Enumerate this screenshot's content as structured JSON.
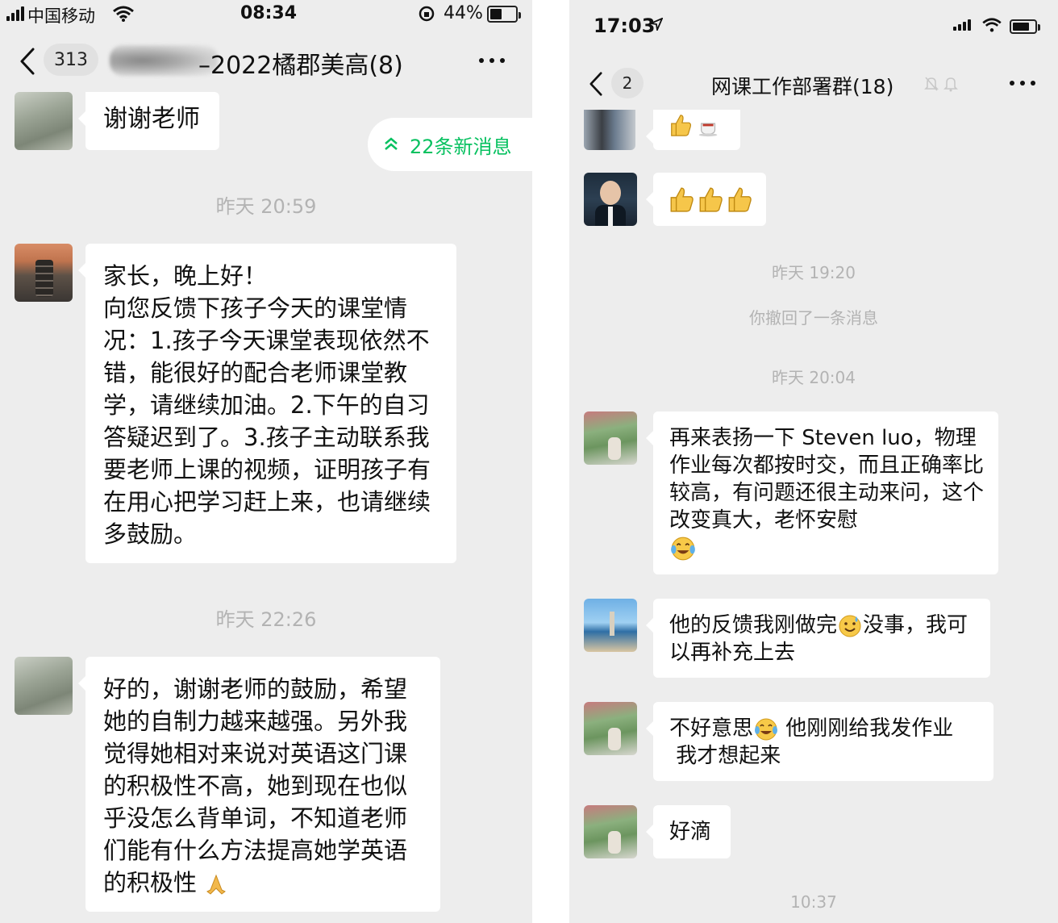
{
  "left": {
    "status": {
      "carrier": "中国移动",
      "time": "08:34",
      "battery": "44%"
    },
    "nav": {
      "back_count": "313",
      "title": "–2022橘郡美高(8)"
    },
    "new_messages_pill": "22条新消息",
    "messages": [
      {
        "type": "text",
        "text": "谢谢老师"
      },
      {
        "type": "time",
        "text": "昨天 20:59"
      },
      {
        "type": "text",
        "text": "家长，晚上好！\n向您反馈下孩子今天的课堂情况：1.孩子今天课堂表现依然不错，能很好的配合老师课堂教学，请继续加油。2.下午的自习答疑迟到了。3.孩子主动联系我要老师上课的视频，证明孩子有在用心把学习赶上来，也请继续多鼓励。"
      },
      {
        "type": "time",
        "text": "昨天 22:26"
      },
      {
        "type": "text",
        "text": "好的，谢谢老师的鼓励，希望她的自制力越来越强。另外我觉得她相对来说对英语这门课的积极性不高，她到现在也似乎没怎么背单词，不知道老师们能有什么方法提高她学英语的积极性"
      }
    ]
  },
  "right": {
    "status": {
      "time": "17:03"
    },
    "nav": {
      "back_count": "2",
      "title": "网课工作部署群(18)"
    },
    "messages": [
      {
        "type": "emoji",
        "emojis": [
          "thumbs-up",
          "coffee"
        ]
      },
      {
        "type": "emoji",
        "emojis": [
          "thumbs-up",
          "thumbs-up",
          "thumbs-up"
        ]
      },
      {
        "type": "time",
        "text": "昨天 19:20"
      },
      {
        "type": "system",
        "text": "你撤回了一条消息"
      },
      {
        "type": "time",
        "text": "昨天 20:04"
      },
      {
        "type": "text",
        "text": "再来表扬一下 Steven luo，物理作业每次都按时交，而且正确率比较高，有问题还很主动来问，这个改变真大，老怀安慰"
      },
      {
        "type": "text",
        "text_a": "他的反馈我刚做完",
        "text_b": "没事，我可以再补充上去"
      },
      {
        "type": "text",
        "text_a": "不好意思",
        "text_b": " 他刚刚给我发作业\n 我才想起来"
      },
      {
        "type": "text",
        "text": "好滴"
      },
      {
        "type": "time",
        "text": "10:37"
      }
    ]
  },
  "icons": {
    "emoji_tears_of_joy": "tears-of-joy-emoji",
    "emoji_sweat": "sweat-smile-emoji",
    "emoji_pray": "folded-hands-emoji"
  },
  "colors": {
    "background": "#ededed",
    "bubble": "#ffffff",
    "accent_green": "#07c160",
    "timestamp": "#b3b3b3"
  }
}
